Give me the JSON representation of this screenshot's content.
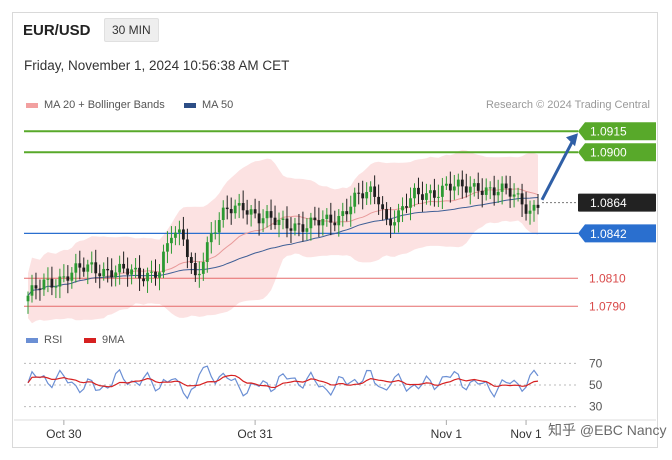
{
  "header": {
    "symbol": "EUR/USD",
    "timeframe": "30 MIN"
  },
  "datetime": "Friday, November 1, 2024 10:56:38 AM CET",
  "legend": {
    "items": [
      {
        "label": "MA 20 + Bollinger Bands",
        "color": "#f2a0a0"
      },
      {
        "label": "MA 50",
        "color": "#2d4e86"
      }
    ],
    "credit": "Research © 2024 Trading Central"
  },
  "rsi_legend": {
    "items": [
      {
        "label": "RSI",
        "color": "#6b8fd4"
      },
      {
        "label": "9MA",
        "color": "#d62020"
      }
    ]
  },
  "watermark": "知乎 @EBC Nancy",
  "chart_data": [
    {
      "type": "candlestick",
      "ylim": [
        1.0778,
        1.0928
      ],
      "x_ticks": [
        {
          "label": "Oct 30",
          "index": 9
        },
        {
          "label": "Oct 31",
          "index": 57
        },
        {
          "label": "Nov 1",
          "index": 105
        },
        {
          "label": "Nov 1",
          "index": 125
        }
      ],
      "levels": [
        {
          "value": 1.0915,
          "label": "1.0915",
          "style": "resistance"
        },
        {
          "value": 1.09,
          "label": "1.0900",
          "style": "resistance"
        },
        {
          "value": 1.0864,
          "label": "1.0864",
          "style": "current"
        },
        {
          "value": 1.0842,
          "label": "1.0842",
          "style": "pivot"
        },
        {
          "value": 1.081,
          "label": "1.0810",
          "style": "support"
        },
        {
          "value": 1.079,
          "label": "1.0790",
          "style": "support"
        }
      ],
      "forecast_arrow": {
        "from": 1.0866,
        "to": 1.0915
      },
      "colors": {
        "up": "#2c9a32",
        "down": "#1f1f1f",
        "resistance": "#58a92a",
        "pivot": "#2a6fcf",
        "support": "#e56b6b",
        "current": "#333333"
      }
    },
    {
      "type": "line",
      "name": "RSI",
      "y_ticks": [
        70,
        50,
        30
      ],
      "ylim": [
        25,
        75
      ]
    }
  ]
}
